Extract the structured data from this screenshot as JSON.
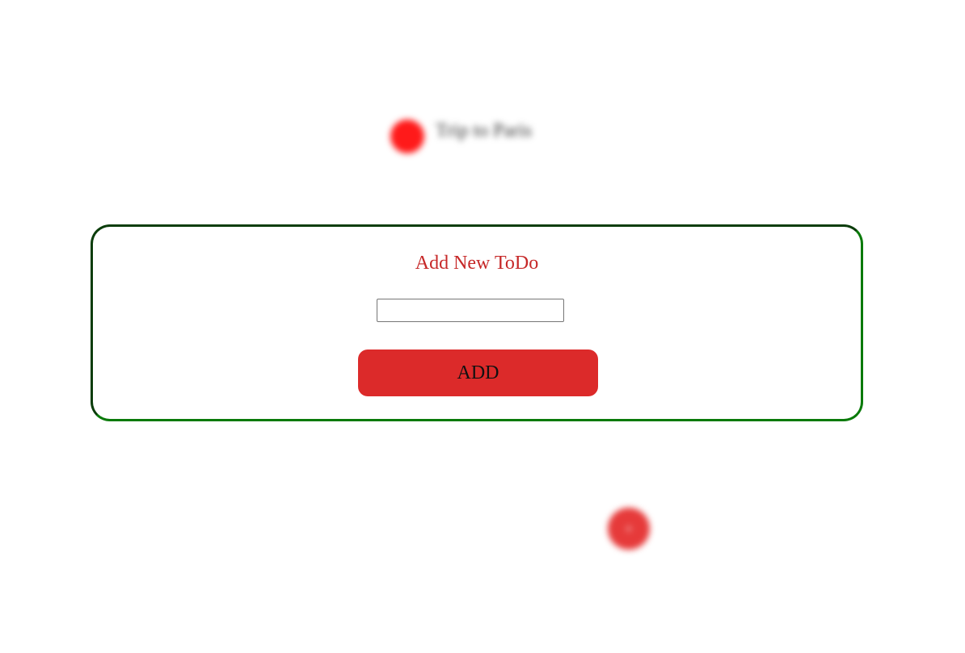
{
  "background": {
    "todo_item_label": "Trip to Paris",
    "fab_label": "+"
  },
  "modal": {
    "title": "Add New ToDo",
    "input_value": "",
    "input_placeholder": "",
    "add_button_label": "ADD"
  },
  "colors": {
    "accent_red": "#dc2a2a",
    "title_red": "#c62828",
    "border_green": "#0a7a0a"
  }
}
